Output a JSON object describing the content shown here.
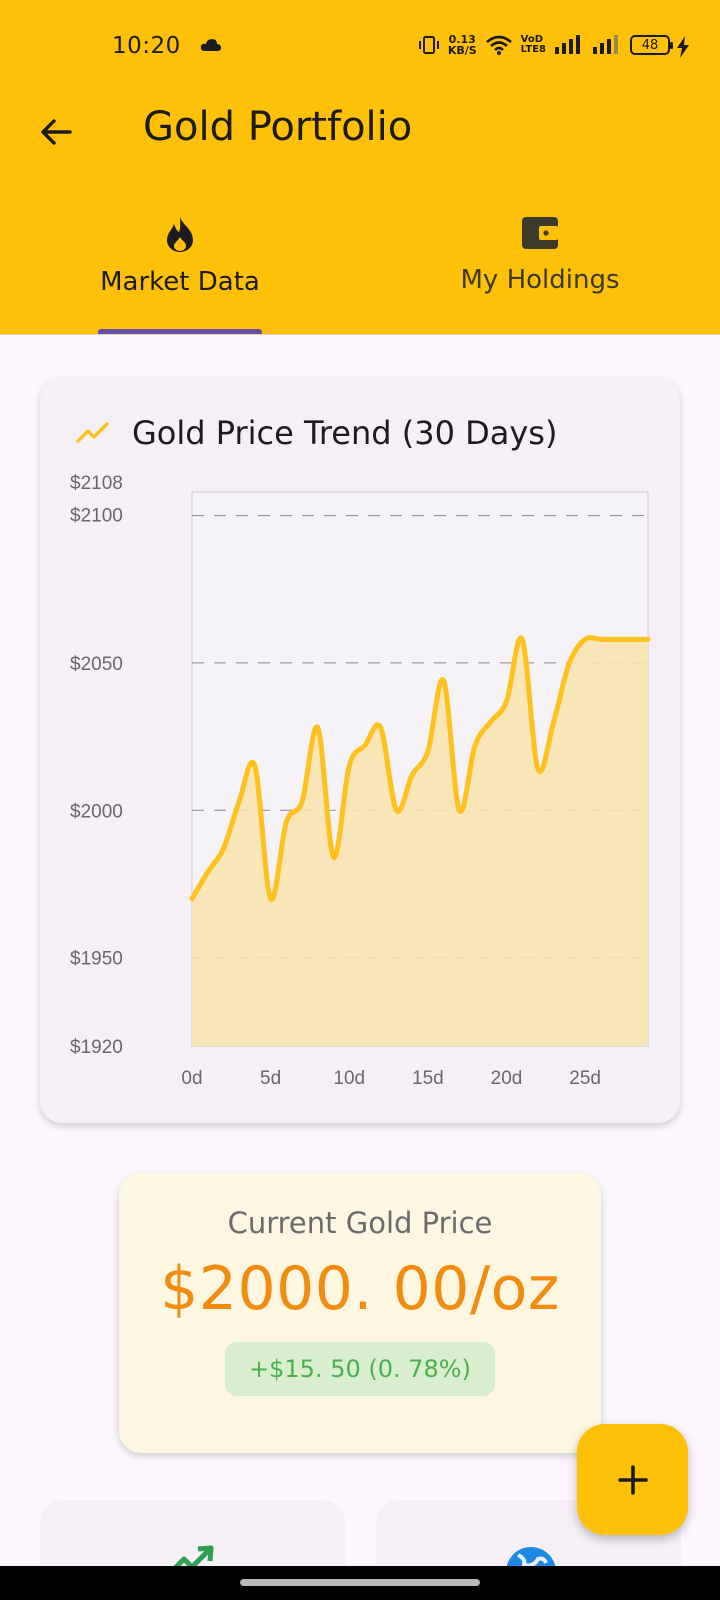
{
  "status_bar": {
    "time": "10:20",
    "net_speed_value": "0.13",
    "net_speed_unit": "KB/S",
    "volte_top": "VoD",
    "volte_bottom": "LTE8",
    "battery": "48"
  },
  "app_bar": {
    "title": "Gold Portfolio"
  },
  "tabs": [
    {
      "label": "Market Data",
      "icon": "flame-icon",
      "selected": true
    },
    {
      "label": "My Holdings",
      "icon": "wallet-icon",
      "selected": false
    }
  ],
  "chart_card": {
    "title": "Gold Price Trend (30 Days)"
  },
  "chart_data": {
    "type": "area",
    "title": "Gold Price Trend (30 Days)",
    "xlabel": "",
    "ylabel": "",
    "xlim": [
      0,
      29
    ],
    "ylim": [
      1920,
      2108
    ],
    "x_ticks": [
      0,
      5,
      10,
      15,
      20,
      25
    ],
    "x_tick_labels": [
      "0d",
      "5d",
      "10d",
      "15d",
      "20d",
      "25d"
    ],
    "y_ticks": [
      1920,
      1950,
      2000,
      2050,
      2100,
      2108
    ],
    "y_tick_labels": [
      "$1920",
      "$1950",
      "$2000",
      "$2050",
      "$2100",
      "$2108"
    ],
    "grid": "dashed horizontal",
    "series": [
      {
        "color": "#FFC11E",
        "fill": "#F8E3B0",
        "x": [
          0,
          1,
          2,
          3,
          4,
          5,
          6,
          7,
          8,
          9,
          10,
          11,
          12,
          13,
          14,
          15,
          16,
          17,
          18,
          19,
          20,
          21,
          22,
          23,
          24,
          25,
          26,
          27,
          28,
          29
        ],
        "values": [
          1970,
          1979,
          1987,
          2003,
          2015,
          1970,
          1996,
          2003,
          2028,
          1984,
          2015,
          2022,
          2028,
          2000,
          2012,
          2020,
          2044,
          2000,
          2022,
          2030,
          2037,
          2058,
          2014,
          2030,
          2050,
          2058,
          2058,
          2058,
          2058,
          2058
        ]
      }
    ]
  },
  "price_card": {
    "label": "Current Gold Price",
    "value": "$2000. 00/oz",
    "change": "+$15. 50 (0. 78%)"
  },
  "colors": {
    "primary": "#FFC107",
    "tab_indicator": "#6750A4",
    "price": "#F28C0F",
    "positive": "#4CAF50"
  }
}
